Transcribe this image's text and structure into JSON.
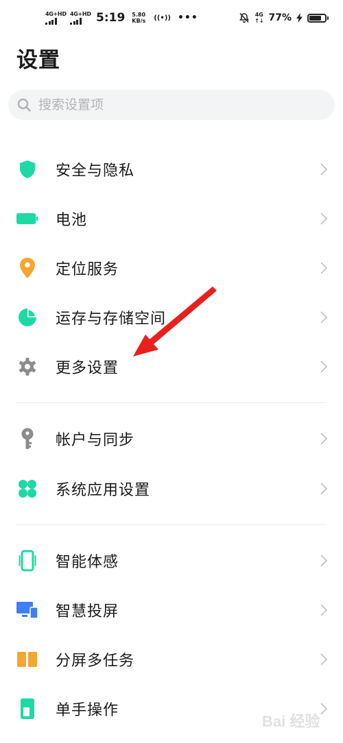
{
  "status_bar": {
    "sim1": "4G+HD",
    "sim2": "4G+HD",
    "time": "5:19",
    "speed_value": "5.80",
    "speed_unit": "KB/s",
    "hotspot": "((•))",
    "more": "•••",
    "network_right": "4G",
    "network_right_sub": "↑↓",
    "battery": "77%",
    "battery_level": 0.77
  },
  "header": {
    "title": "设置"
  },
  "search": {
    "placeholder": "搜索设置项"
  },
  "groups": [
    {
      "items": [
        {
          "label": "安全与隐私",
          "icon": "shield-icon",
          "color": "#1ed9a4"
        },
        {
          "label": "电池",
          "icon": "battery-icon",
          "color": "#1ed9a4"
        },
        {
          "label": "定位服务",
          "icon": "location-pin-icon",
          "color": "#f5a531"
        },
        {
          "label": "运存与存储空间",
          "icon": "storage-pie-icon",
          "color": "#1ed9a4"
        },
        {
          "label": "更多设置",
          "icon": "gear-icon",
          "color": "#8c8c8c"
        }
      ]
    },
    {
      "items": [
        {
          "label": "帐户与同步",
          "icon": "key-icon",
          "color": "#8c8c8c"
        },
        {
          "label": "系统应用设置",
          "icon": "apps-grid-icon",
          "color": "#1ed9a4"
        }
      ]
    },
    {
      "items": [
        {
          "label": "智能体感",
          "icon": "phone-motion-icon",
          "color": "#1ed9a4"
        },
        {
          "label": "智慧投屏",
          "icon": "screen-cast-icon",
          "color": "#3f7ef3"
        },
        {
          "label": "分屏多任务",
          "icon": "split-screen-icon",
          "color": "#f5a531"
        },
        {
          "label": "单手操作",
          "icon": "one-hand-icon",
          "color": "#1ed9a4"
        }
      ]
    }
  ],
  "annotation": {
    "arrow_color": "#e8201e"
  },
  "watermark": {
    "text": "Bai 经验"
  }
}
